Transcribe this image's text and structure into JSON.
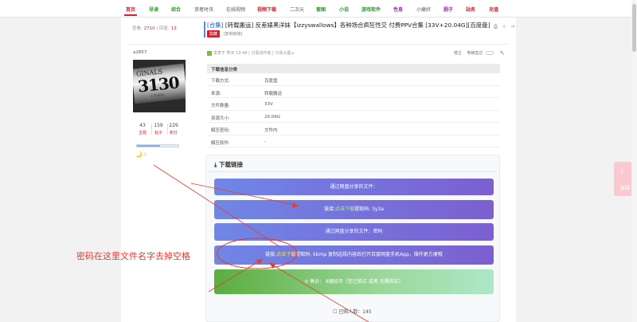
{
  "nav": {
    "items": [
      {
        "label": "首页",
        "style": "active"
      },
      {
        "label": "导读",
        "style": "green"
      },
      {
        "label": "综合",
        "style": "green"
      },
      {
        "label": "资者时讯",
        "style": "normal"
      },
      {
        "label": "在线视频",
        "style": "normal"
      },
      {
        "label": "视频下载",
        "style": "red"
      },
      {
        "label": "二次元",
        "style": "normal"
      },
      {
        "label": "套图",
        "style": "green"
      },
      {
        "label": "小说",
        "style": "green"
      },
      {
        "label": "游戏软件",
        "style": "green"
      },
      {
        "label": "性息",
        "style": "purple"
      },
      {
        "label": "小癖好",
        "style": "normal"
      },
      {
        "label": "厕子",
        "style": "purple"
      },
      {
        "label": "站务",
        "style": "red"
      },
      {
        "label": "充值",
        "style": "red"
      }
    ]
  },
  "post": {
    "stats_views_label": "查看:",
    "stats_views": "2710",
    "stats_sep": " | ",
    "stats_replies_label": "回复:",
    "stats_replies": "13",
    "title_prefix": "[合集]",
    "title_body": " [转载搬运] 反差婊黑洋妹【izzyswallows】各种场合疯狂性交 付费PPV合集 [33V+20.04G][百度盘]",
    "tag_red": "隐藏",
    "tag_gray": "[复制链接]",
    "title_icons": "⎙ ☆ ⇨"
  },
  "user": {
    "username": "a2857",
    "avatar_text_top": "GINALS",
    "avatar_text_big": "3130",
    "avatar_text_small": "175|45A",
    "stats": [
      {
        "value": "43",
        "label": "主题"
      },
      {
        "value": "159",
        "label": "帖子"
      },
      {
        "value": "229",
        "label": "积分"
      }
    ],
    "level_progress": 0.55,
    "medals": "🌙☆"
  },
  "meta": {
    "left": "发表于 昨天 10:48  |  只看该作者  |  只看大图 ▸",
    "right_label": "楼主",
    "right_label2": "电梯直达",
    "wrench_icon": "wrench-icon"
  },
  "info": {
    "header": "下载信息分类",
    "rows": [
      {
        "key": "下载方式:",
        "value": "百度盘"
      },
      {
        "key": "来源:",
        "value": "转载搬运"
      },
      {
        "key": "文件数量:",
        "value": "33V"
      },
      {
        "key": "资源大小:",
        "value": "20.04G"
      },
      {
        "key": "解压密码:",
        "value": "文件内"
      },
      {
        "key": "解压软件:",
        "value": "-"
      }
    ]
  },
  "download": {
    "title": "下载链接",
    "row1": "通过网盘分享的文件：",
    "row2_pre": "链接:",
    "row2_link": "点击下载",
    "row2_post": "提取码: 3y3a",
    "row3": "通过网盘分享的文件：密码",
    "row4_pre": "链接:",
    "row4_link": "点击下载",
    "row4_post": "提取码: kbmp 复制这段内容后打开百度网盘手机App，操作更方便哦",
    "buy": "售价：  8银娃币（您已购买 或者 无需购买）",
    "buyers": "☐ 已购人数：145"
  },
  "float": {
    "label": "客服"
  },
  "annotation": {
    "text": "密码在这里文件名字去掉空格",
    "color": "#e53b2e"
  }
}
